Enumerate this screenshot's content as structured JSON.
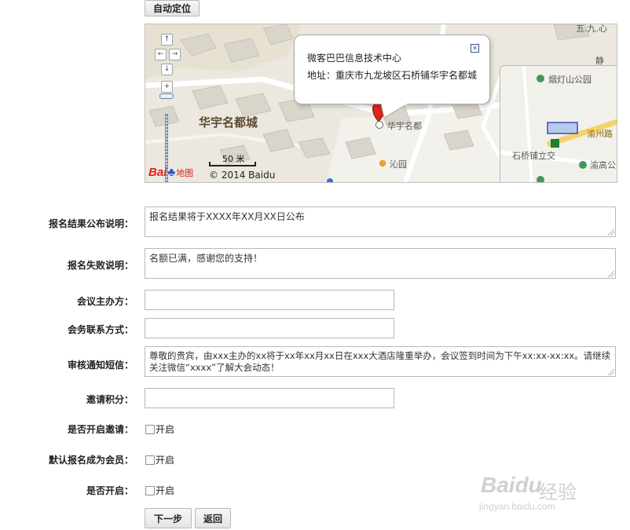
{
  "toolbar": {
    "locate_label": "自动定位"
  },
  "map": {
    "place_label": "华宇名都城",
    "poi_huayu": "华宇名都",
    "poi_qinyuan": "沁园",
    "top_right_fragment": "五.九.心",
    "jing_fragment": "静",
    "scale_text": "50 米",
    "copyright": "© 2014 Baidu",
    "logo_bai": "Bai",
    "logo_du": "地图",
    "popup": {
      "title": "微客巴巴信息技术中心",
      "address": "地址：重庆市九龙坡区石桥铺华宇名都城"
    },
    "overview": {
      "park": "烟灯山公园",
      "road": "渝州路",
      "station": "石桥铺立交",
      "park2": "渝高公园"
    }
  },
  "form": {
    "result_label": "报名结果公布说明：",
    "result_value": "报名结果将于XXXX年XX月XX日公布",
    "fail_label": "报名失败说明：",
    "fail_value": "名额已满，感谢您的支持！",
    "organizer_label": "会议主办方：",
    "contact_label": "会务联系方式：",
    "sms_label": "审核通知短信：",
    "sms_value": "尊敬的贵宾，由xxx主办的xx将于xx年xx月xx日在xxx大酒店隆重举办，会议签到时间为下午xx:xx-xx:xx。请继续关注微信“xxxx”了解大会动态！",
    "points_label": "邀请积分：",
    "invite_label": "是否开启邀请：",
    "member_label": "默认报名成为会员：",
    "enable_label": "是否开启：",
    "checkbox_text": "开启"
  },
  "buttons": {
    "next": "下一步",
    "back": "返回"
  },
  "watermark": {
    "brand": "Baidu",
    "cn": "经验",
    "url": "jingyan.baidu.com"
  }
}
